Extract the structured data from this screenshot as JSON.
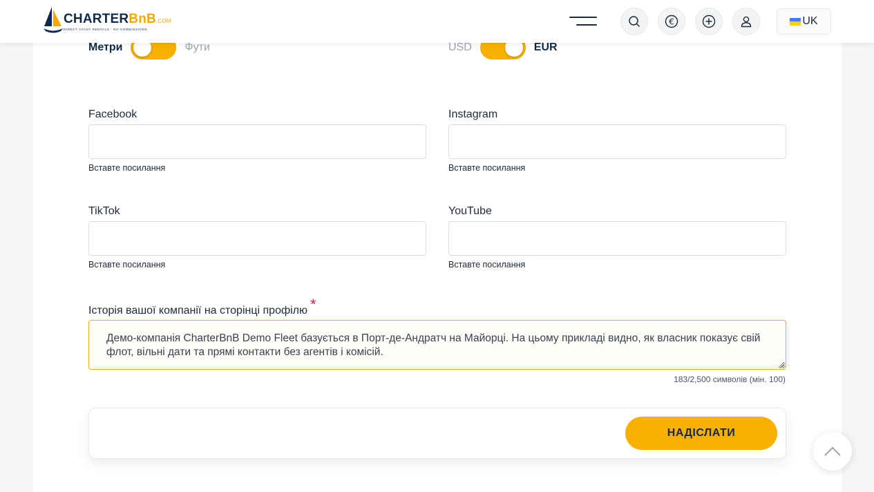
{
  "header": {
    "logo": {
      "name_part1": "CHARTER",
      "name_part2": "BnB",
      "name_suffix": ".COM",
      "tagline": "DIRECT YACHT RENTALS · NO COMMISSIONS"
    },
    "icons": {
      "menu": "hamburger-icon",
      "search": "search-icon",
      "currency": "euro-icon",
      "add": "plus-circle-icon",
      "user": "user-icon"
    },
    "language": "UK"
  },
  "units_toggle": {
    "left_label": "Метри",
    "right_label": "Фути",
    "selected": "Метри"
  },
  "currency_toggle": {
    "left_label": "USD",
    "right_label": "EUR",
    "selected": "EUR"
  },
  "social": {
    "facebook": {
      "label": "Facebook",
      "value": "",
      "hint": "Вставте посилання"
    },
    "instagram": {
      "label": "Instagram",
      "value": "",
      "hint": "Вставте посилання"
    },
    "tiktok": {
      "label": "TikTok",
      "value": "",
      "hint": "Вставте посилання"
    },
    "youtube": {
      "label": "YouTube",
      "value": "",
      "hint": "Вставте посилання"
    }
  },
  "company_story": {
    "label": "Історія вашої компанії на сторінці профілю",
    "required_mark": "*",
    "value": "Демо-компанія CharterBnB Demo Fleet базується в Порт-де-Андратч на Майорці. На цьому прикладі видно, як власник показує свій флот, вільні дати та прямі контакти без агентів і комісій.",
    "char_count": "183/2,500 символів (мін. 100)"
  },
  "submit": {
    "label": "НАДІСЛАТИ"
  },
  "colors": {
    "accent": "#f9b000",
    "navy": "#0d2a4a",
    "required": "#e11d48"
  }
}
